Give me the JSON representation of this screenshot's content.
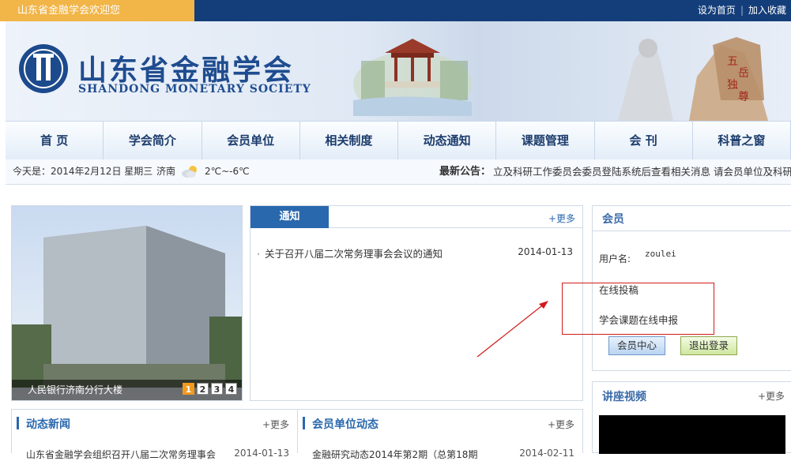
{
  "topbar": {
    "welcome": "山东省金融学会欢迎您",
    "set_home": "设为首页",
    "separator": "|",
    "add_favorite": "加入收藏"
  },
  "logo": {
    "name_cn": "山东省金融学会",
    "name_en": "SHANDONG MONETARY SOCIETY"
  },
  "nav": {
    "items": [
      "首  页",
      "学会简介",
      "会员单位",
      "相关制度",
      "动态通知",
      "课题管理",
      "会  刊",
      "科普之窗"
    ]
  },
  "infobar": {
    "date": "今天是：2014年2月12日  星期三",
    "city": "济南",
    "weather_icon": "cloudy-sun-icon",
    "temperature": "2℃~-6℃",
    "notice_label": "最新公告：",
    "notice_text": "立及科研工作委员会委员登陆系统后查看相关消息  请会员单位及科研工"
  },
  "photo": {
    "caption": "人民银行济南分行大楼",
    "pages": [
      "1",
      "2",
      "3",
      "4"
    ],
    "active_page": "1"
  },
  "notice": {
    "tab": "通知",
    "more": "+更多",
    "items": [
      {
        "title": "关于召开八届二次常务理事会会议的通知",
        "date": "2014-01-13"
      }
    ]
  },
  "member": {
    "title": "会员",
    "user_label": "用户名:",
    "user_name": "zoulei",
    "link_submit": "在线投稿",
    "link_apply": "学会课题在线申报",
    "btn_center": "会员中心",
    "btn_logout": "退出登录"
  },
  "lecture": {
    "title": "讲座视频",
    "more": "+更多"
  },
  "news": {
    "title": "动态新闻",
    "more": "+更多",
    "item": "山东省金融学会组织召开八届二次常务理事会",
    "date": "2014-01-13"
  },
  "unit_news": {
    "title": "会员单位动态",
    "more": "+更多",
    "item": "金融研究动态2014年第2期（总第18期",
    "date": "2014-02-11"
  },
  "colors": {
    "topbar_bg": "#143e7a",
    "welcome_bg": "#f1b548",
    "accent": "#2a68ad",
    "annotation_red": "#d21a1a"
  }
}
